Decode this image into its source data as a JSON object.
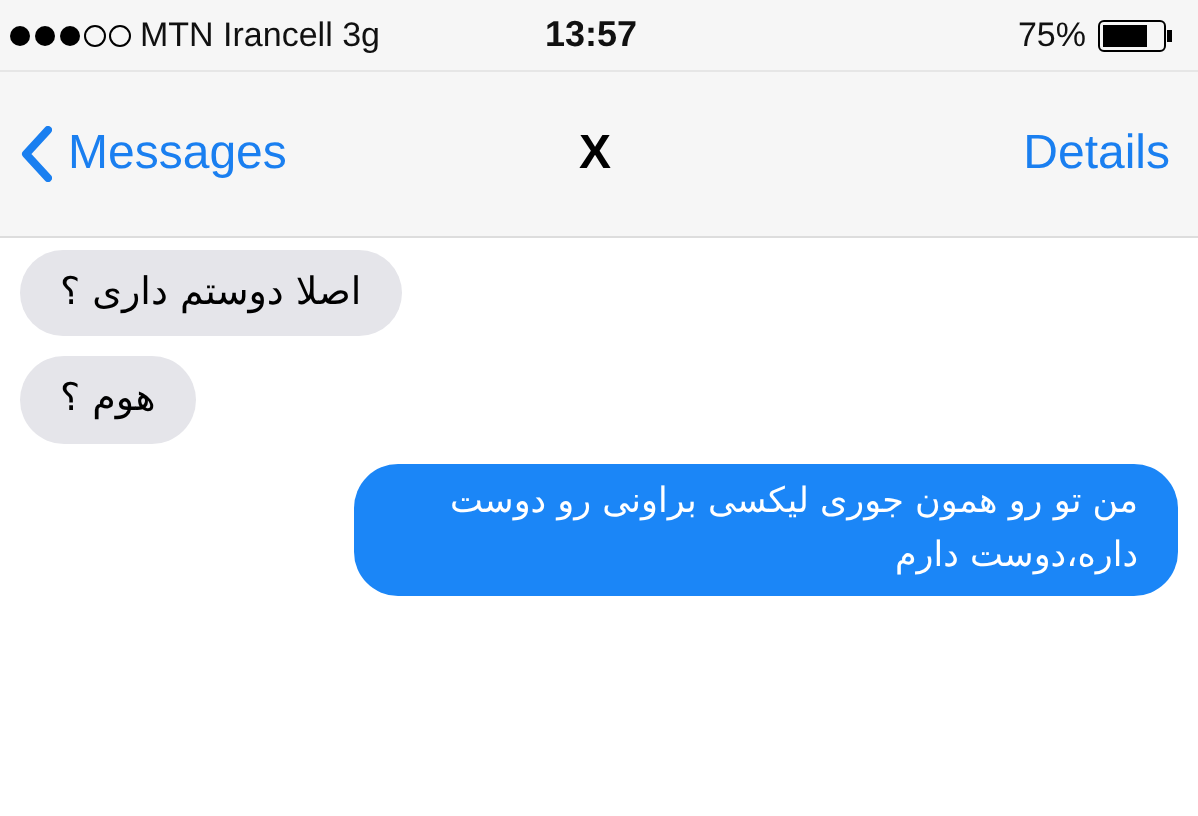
{
  "status_bar": {
    "carrier": "MTN Irancell 3g",
    "time": "13:57",
    "battery": "75%"
  },
  "nav": {
    "back": "Messages",
    "title": "X",
    "details": "Details"
  },
  "messages": [
    {
      "kind": "incoming",
      "text": "اصلا دوستم داری ؟"
    },
    {
      "kind": "incoming",
      "text": "هوم ؟"
    },
    {
      "kind": "outgoing",
      "text": "من تو رو همون جوری لیکسی براونی رو دوست داره،دوست دارم"
    }
  ]
}
